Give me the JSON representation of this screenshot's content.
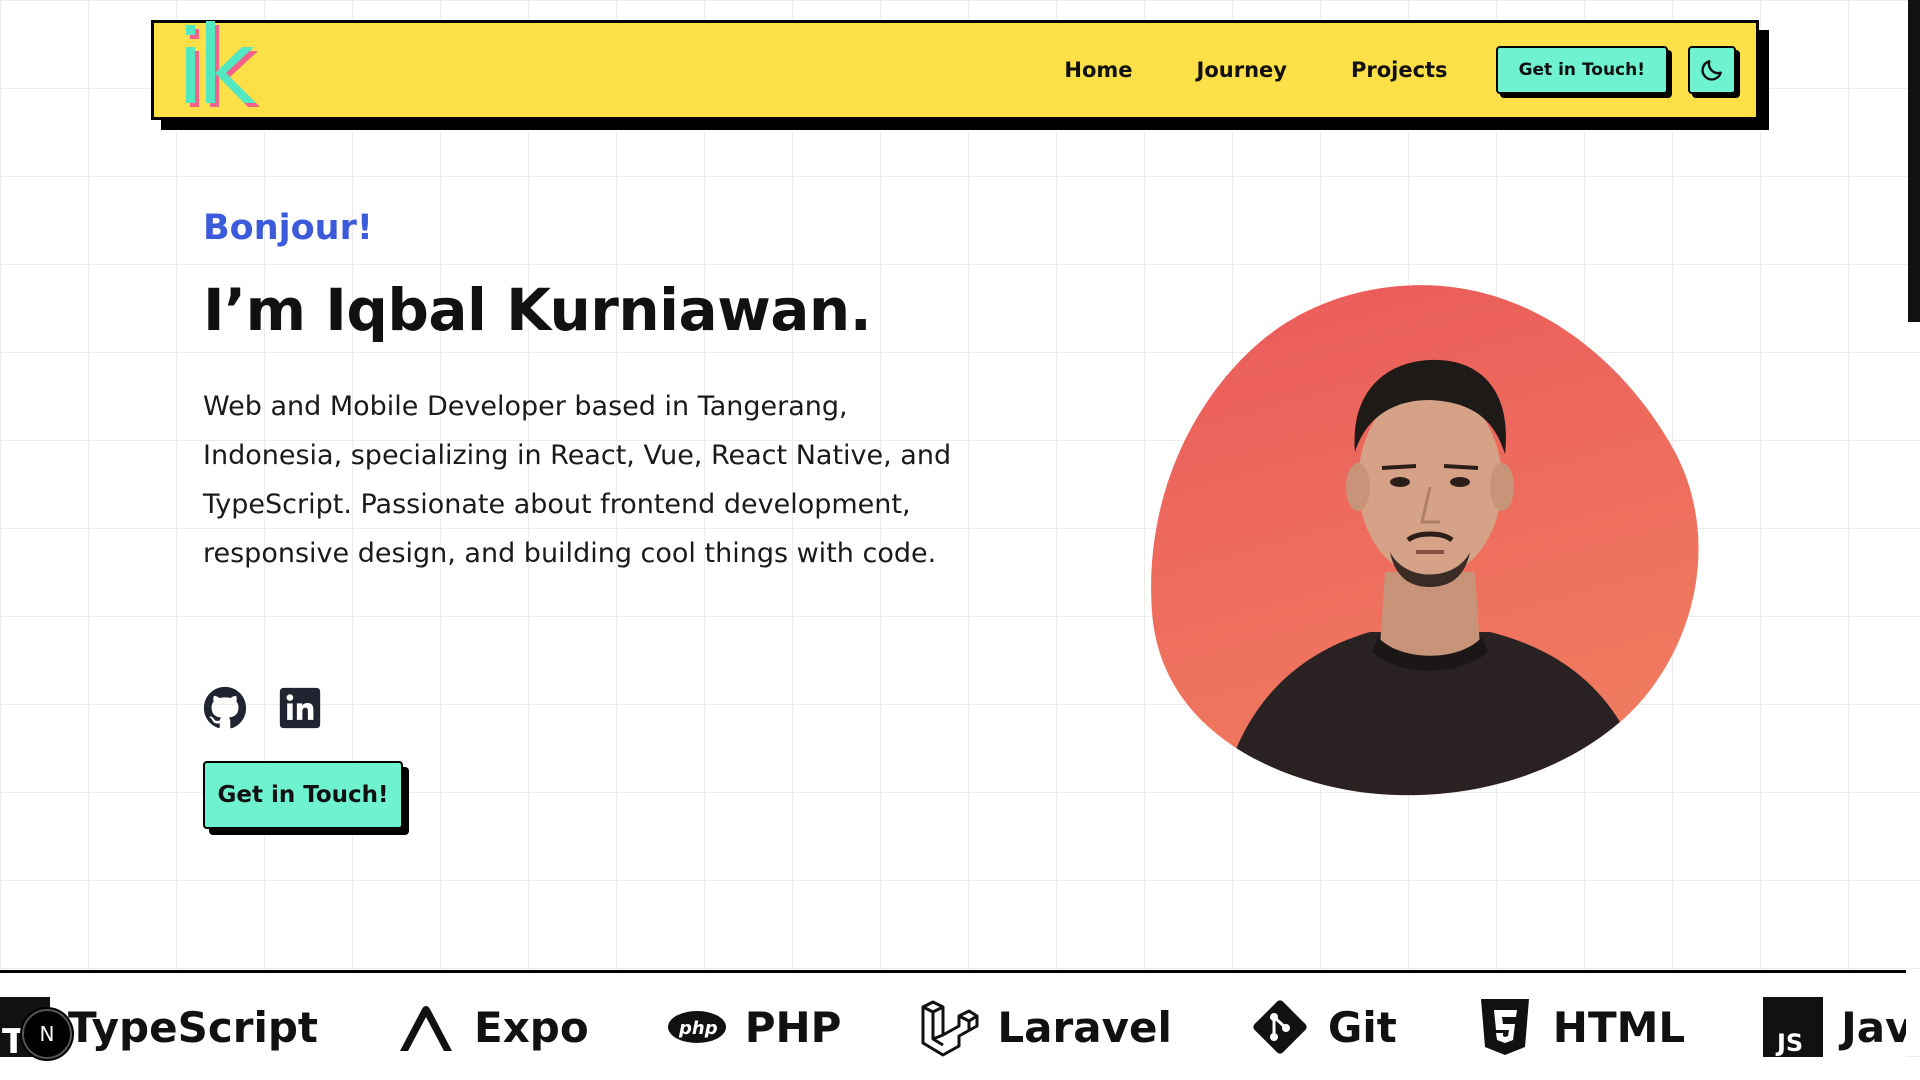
{
  "navbar": {
    "logo_text": "ik",
    "links": [
      "Home",
      "Journey",
      "Projects"
    ],
    "cta_label": "Get in Touch!",
    "theme_icon": "moon-icon"
  },
  "hero": {
    "greeting": "Bonjour!",
    "title": "I’m Iqbal Kurniawan.",
    "description": "Web and Mobile Developer based in Tangerang, Indonesia, specializing in React, Vue, React Native, and TypeScript. Passionate about frontend development, responsive design, and building cool things with code.",
    "socials": [
      "github-icon",
      "linkedin-icon"
    ],
    "cta_label": "Get in Touch!"
  },
  "tech_stack": [
    {
      "label": "TypeScript",
      "icon": "typescript-icon"
    },
    {
      "label": "Expo",
      "icon": "expo-icon"
    },
    {
      "label": "PHP",
      "icon": "php-icon"
    },
    {
      "label": "Laravel",
      "icon": "laravel-icon"
    },
    {
      "label": "Git",
      "icon": "git-icon"
    },
    {
      "label": "HTML",
      "icon": "html5-icon"
    },
    {
      "label": "Java",
      "icon": "javascript-icon"
    }
  ],
  "dev_badge": "N",
  "colors": {
    "navbar_bg": "#fde047",
    "accent_mint": "#6ef2cf",
    "greeting_blue": "#3b5bdb",
    "portrait_bg": "#ee6a5c"
  }
}
